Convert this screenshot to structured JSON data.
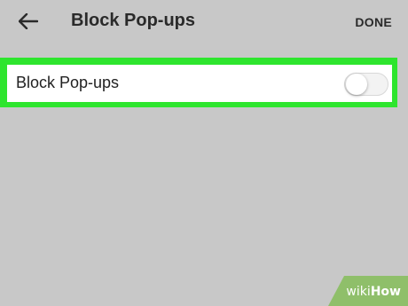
{
  "header": {
    "back_icon": "arrow-left-icon",
    "title": "Block Pop-ups",
    "done_label": "DONE"
  },
  "settings": {
    "block_popups": {
      "label": "Block Pop-ups",
      "enabled": false
    }
  },
  "colors": {
    "background": "#c8c8c8",
    "highlight": "#2ee52e",
    "row_background": "#ffffff",
    "watermark_green": "#8fbf6a"
  },
  "watermark": {
    "prefix": "wiki",
    "suffix": "How"
  }
}
